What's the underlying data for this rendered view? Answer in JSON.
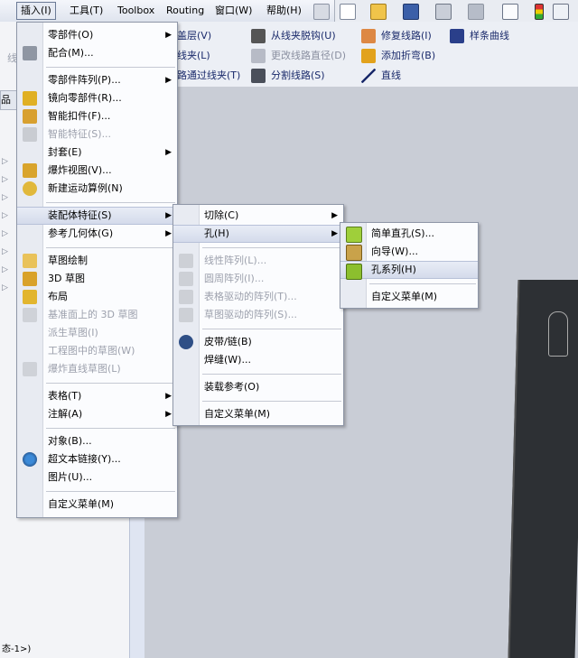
{
  "menubar": {
    "items": [
      {
        "label": "插入(I)",
        "active": true
      },
      {
        "label": "工具(T)"
      },
      {
        "label": "Toolbox"
      },
      {
        "label": "Routing"
      },
      {
        "label": "窗口(W)"
      },
      {
        "label": "帮助(H)"
      }
    ],
    "toolbar_icons": [
      "pin-icon",
      "new-document-icon",
      "open-folder-icon",
      "save-icon",
      "print-icon",
      "undo-icon",
      "select-cursor-icon",
      "traffic-light-icon",
      "options-icon"
    ]
  },
  "commands": {
    "row1": [
      {
        "label": "盖层(V)",
        "icon": "layer-icon",
        "dim": false
      },
      {
        "label": "从线夹脱钩(U)",
        "icon": "unhook-clip-icon",
        "dim": false
      },
      {
        "label": "修复线路(I)",
        "icon": "repair-route-icon",
        "dim": false
      },
      {
        "label": "样条曲线",
        "icon": "spline-icon",
        "dim": false
      }
    ],
    "row2": [
      {
        "label": "线夹(L)",
        "icon": "clip-icon",
        "dim": false
      },
      {
        "label": "更改线路直径(D)",
        "icon": "diameter-icon",
        "dim": true
      },
      {
        "label": "添加折弯(B)",
        "icon": "add-bend-icon",
        "dim": false
      }
    ],
    "row3": [
      {
        "label": "路通过线夹(T)",
        "icon": "route-clip-icon",
        "dim": false
      },
      {
        "label": "分割线路(S)",
        "icon": "split-route-icon",
        "dim": false
      },
      {
        "label": "直线",
        "icon": "line-icon",
        "dim": false
      }
    ]
  },
  "leftpanel": {
    "tab_label": "品",
    "status": "态-1>)",
    "left_hint": "线"
  },
  "insert_menu": {
    "items": [
      {
        "label": "零部件(O)",
        "submenu": true,
        "icon": null
      },
      {
        "label": "配合(M)...",
        "icon": "mate-clip-icon"
      },
      {
        "sep": true
      },
      {
        "label": "零部件阵列(P)...",
        "submenu": true,
        "icon": null
      },
      {
        "label": "镜向零部件(R)...",
        "icon": "mirror-component-icon"
      },
      {
        "label": "智能扣件(F)...",
        "icon": "smart-fastener-icon"
      },
      {
        "label": "智能特征(S)...",
        "icon": "smart-feature-icon",
        "dim": true
      },
      {
        "label": "封套(E)",
        "submenu": true,
        "icon": null
      },
      {
        "label": "爆炸视图(V)...",
        "icon": "explode-view-icon"
      },
      {
        "label": "新建运动算例(N)",
        "icon": "motion-study-icon"
      },
      {
        "sep": true
      },
      {
        "label": "装配体特征(S)",
        "submenu": true,
        "highlighted": true,
        "icon": null
      },
      {
        "label": "参考几何体(G)",
        "submenu": true,
        "icon": null
      },
      {
        "sep": true
      },
      {
        "label": "草图绘制",
        "icon": "sketch-icon"
      },
      {
        "label": "3D 草图",
        "icon": "3d-sketch-icon"
      },
      {
        "label": "布局",
        "icon": "layout-icon"
      },
      {
        "label": "基准面上的 3D 草图",
        "icon": "3d-sketch-plane-icon",
        "dim": true
      },
      {
        "label": "派生草图(I)",
        "dim": true
      },
      {
        "label": "工程图中的草图(W)",
        "dim": true
      },
      {
        "label": "爆炸直线草图(L)",
        "icon": "explode-line-icon",
        "dim": true
      },
      {
        "sep": true
      },
      {
        "label": "表格(T)",
        "submenu": true
      },
      {
        "label": "注解(A)",
        "submenu": true
      },
      {
        "sep": true
      },
      {
        "label": "对象(B)...",
        "icon": null
      },
      {
        "label": "超文本链接(Y)...",
        "icon": "hyperlink-icon"
      },
      {
        "label": "图片(U)...",
        "icon": null
      },
      {
        "sep": true
      },
      {
        "label": "自定义菜单(M)"
      }
    ]
  },
  "assembly_features_menu": {
    "items": [
      {
        "label": "切除(C)",
        "submenu": true
      },
      {
        "label": "孔(H)",
        "submenu": true,
        "highlighted": true
      },
      {
        "sep": true
      },
      {
        "label": "线性阵列(L)...",
        "icon": "linear-pattern-icon",
        "dim": true
      },
      {
        "label": "圆周阵列(I)...",
        "icon": "circular-pattern-icon",
        "dim": true
      },
      {
        "label": "表格驱动的阵列(T)...",
        "icon": "table-pattern-icon",
        "dim": true
      },
      {
        "label": "草图驱动的阵列(S)...",
        "icon": "sketch-pattern-icon",
        "dim": true
      },
      {
        "sep": true
      },
      {
        "label": "皮带/链(B)",
        "icon": "belt-chain-icon"
      },
      {
        "label": "焊缝(W)..."
      },
      {
        "sep": true
      },
      {
        "label": "装载参考(O)"
      },
      {
        "sep": true
      },
      {
        "label": "自定义菜单(M)"
      }
    ]
  },
  "hole_menu": {
    "items": [
      {
        "label": "简单直孔(S)...",
        "icon": "simple-hole-icon"
      },
      {
        "label": "向导(W)...",
        "icon": "hole-wizard-icon"
      },
      {
        "label": "孔系列(H)",
        "icon": "hole-series-icon",
        "highlighted": true
      },
      {
        "sep": true
      },
      {
        "label": "自定义菜单(M)"
      }
    ]
  },
  "colors": {
    "menu_bg": "#fbfcfe",
    "highlight": "#d4dbeb",
    "dim_text": "#9da1ad",
    "cmd_text": "#1a2a6b"
  }
}
